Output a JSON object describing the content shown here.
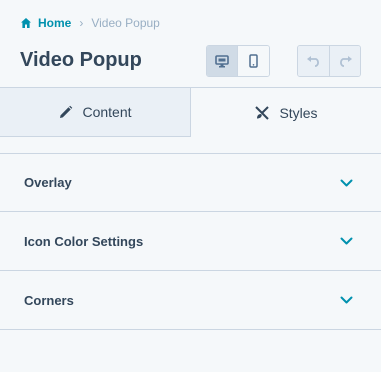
{
  "breadcrumb": {
    "home": "Home",
    "separator": "›",
    "current": "Video Popup"
  },
  "page": {
    "title": "Video Popup"
  },
  "toolbar": {
    "device_modes": [
      "desktop",
      "mobile"
    ],
    "active_device": "desktop",
    "history": [
      "undo",
      "redo"
    ]
  },
  "tabs": [
    {
      "label": "Content",
      "icon": "pencil-icon",
      "active": false
    },
    {
      "label": "Styles",
      "icon": "brush-icon",
      "active": true
    }
  ],
  "sections": [
    {
      "label": "Overlay"
    },
    {
      "label": "Icon Color Settings"
    },
    {
      "label": "Corners"
    }
  ],
  "colors": {
    "accent": "#0091ae",
    "text": "#33475b",
    "muted": "#99afc4",
    "border": "#cbd6e2"
  }
}
